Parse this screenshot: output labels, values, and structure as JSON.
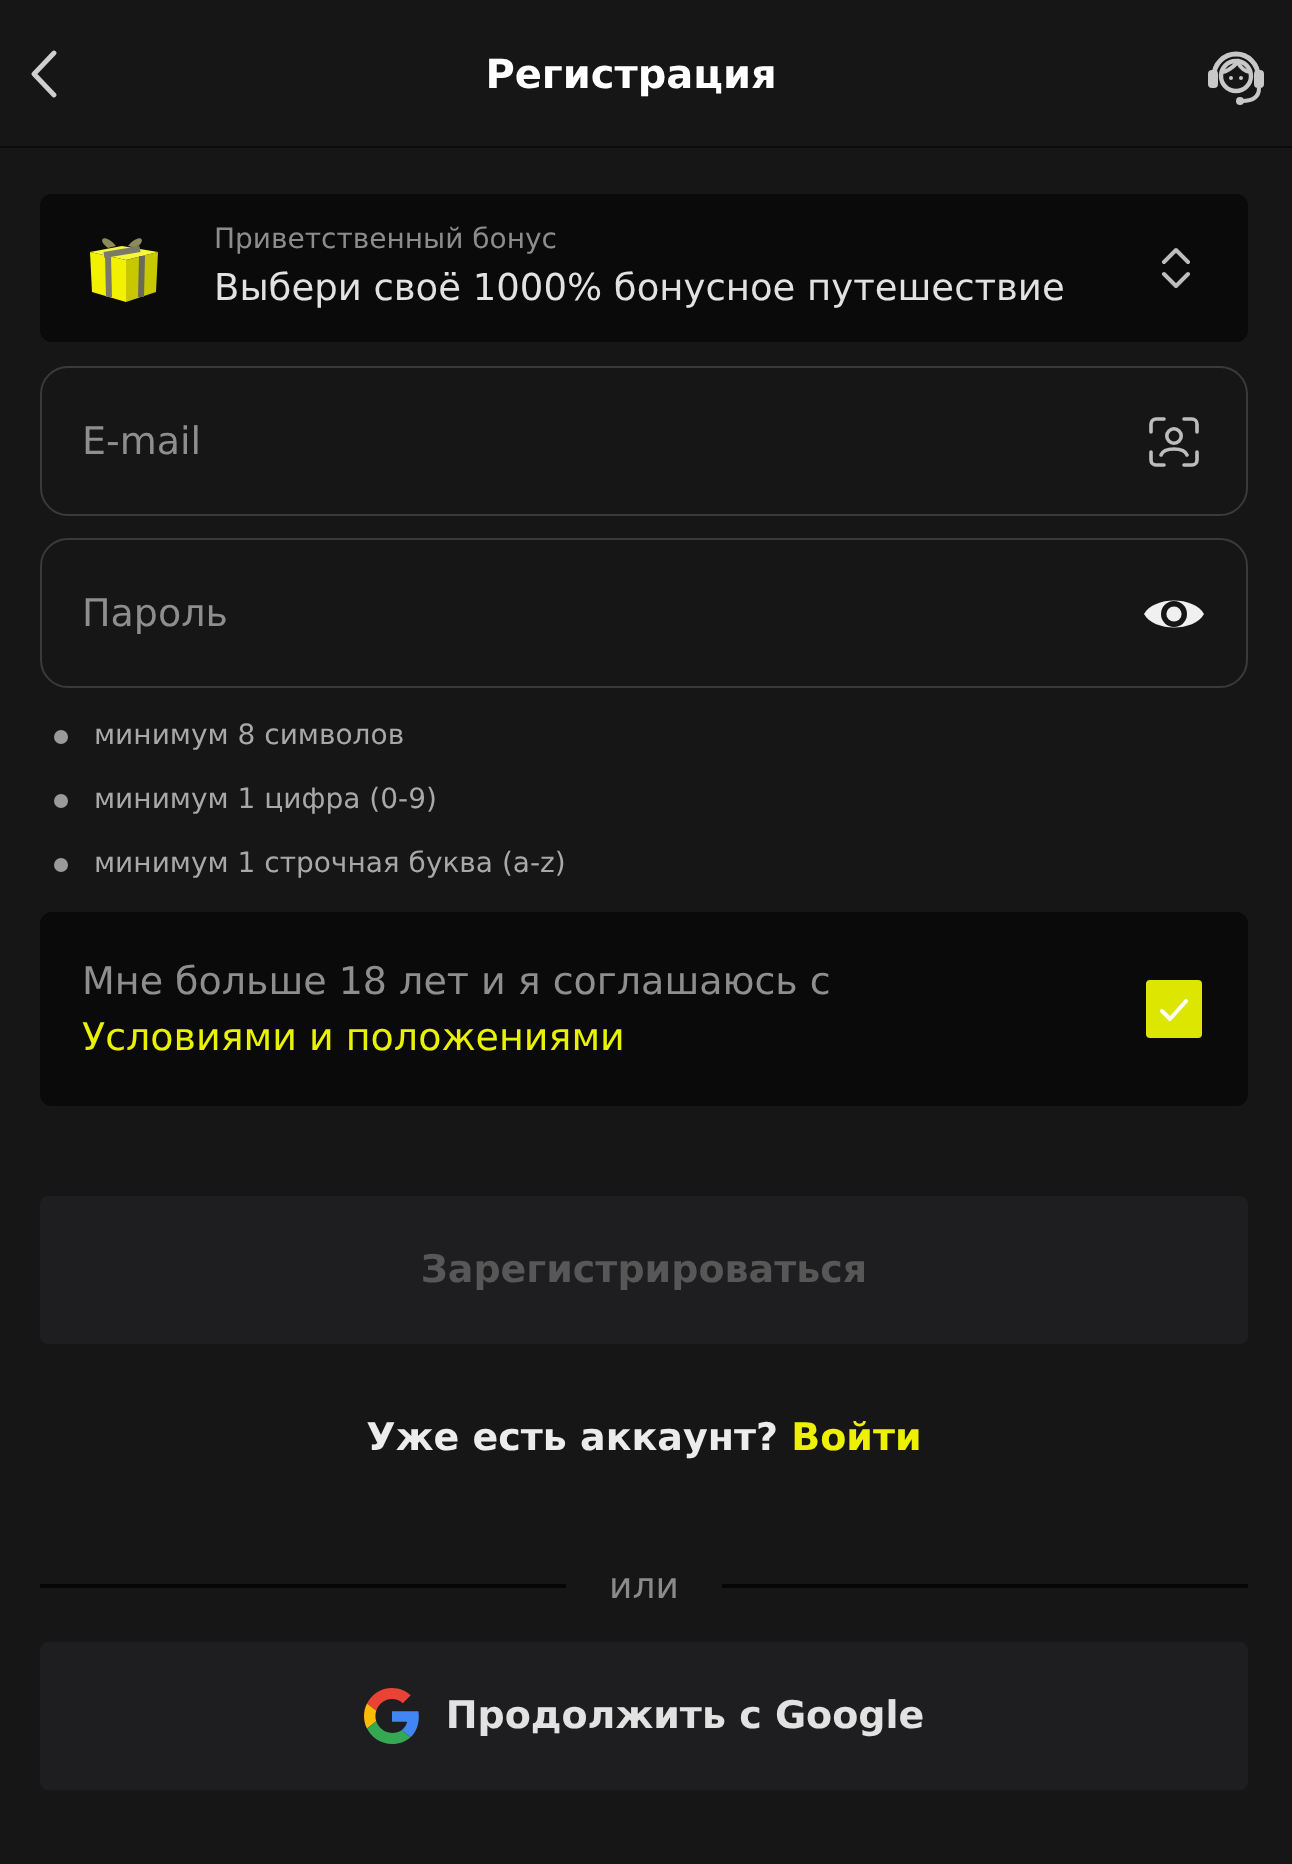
{
  "header": {
    "title": "Регистрация"
  },
  "bonus": {
    "label": "Приветственный бонус",
    "value": "Выбери своё 1000% бонусное путешествие"
  },
  "fields": [
    {
      "kind": "email",
      "placeholder": "E-mail"
    },
    {
      "kind": "password",
      "placeholder": "Пароль"
    }
  ],
  "password_rules": [
    "минимум 8 символов",
    "минимум 1 цифра (0-9)",
    "минимум 1 строчная буква (a-z)"
  ],
  "terms": {
    "text": "Мне больше 18 лет и я соглашаюсь с",
    "link": "Условиями и положениями",
    "checked": true
  },
  "register_button": {
    "label": "Зарегистрироваться",
    "disabled": true
  },
  "login_prompt": {
    "text": "Уже есть аккаунт?",
    "link": "Войти"
  },
  "divider": {
    "label": "или"
  },
  "google_button": {
    "label": "Продолжить с Google"
  }
}
